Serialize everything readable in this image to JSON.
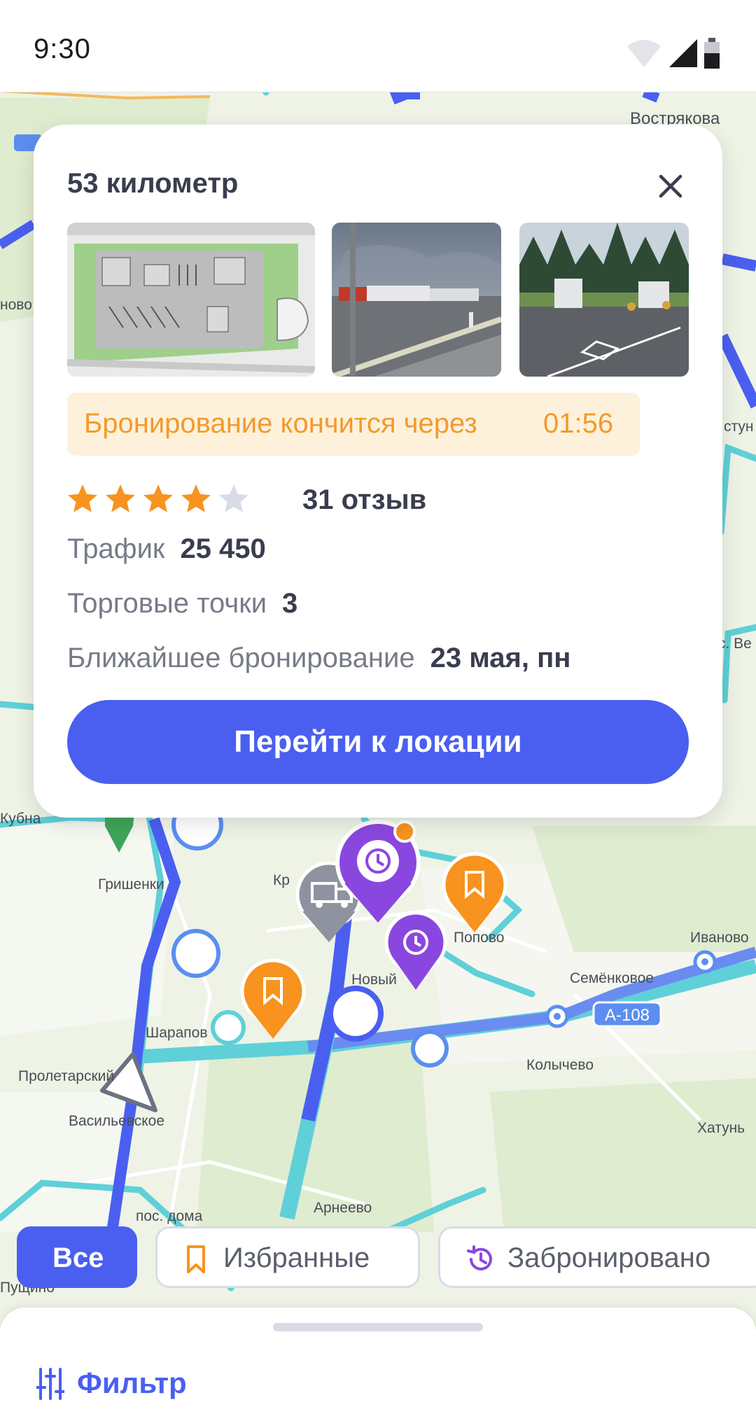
{
  "status_bar": {
    "time": "9:30",
    "icons": [
      "wifi-icon",
      "signal-icon",
      "battery-icon"
    ]
  },
  "map": {
    "places": [
      "Вострякова",
      "Кубна",
      "Гришенки",
      "Кр",
      "Попово",
      "Иваново",
      "Семёнковое",
      "Новый",
      "Шарапов",
      "Пролетарский",
      "Васильевское",
      "Колычево",
      "Хатунь",
      "пос. дома",
      "Арнеево",
      "Пущино",
      "ново",
      "с. Ве",
      "стун"
    ],
    "road_label": "А-108",
    "pin_icons": [
      "history-pin-icon",
      "bookmark-pin-icon",
      "truck-pin-icon",
      "location-pin-icon",
      "navigation-arrow-icon"
    ]
  },
  "card": {
    "title": "53 километр",
    "timer_label": "Бронирование кончится через",
    "timer_value": "01:56",
    "rating": 4,
    "rating_max": 5,
    "reviews": "31 отзыв",
    "traffic_label": "Трафик",
    "traffic_value": "25 450",
    "points_label": "Торговые точки",
    "points_value": "3",
    "booking_label": "Ближайшее бронирование",
    "booking_value": "23 мая, пн",
    "button_label": "Перейти к локации"
  },
  "chips": {
    "all": "Все",
    "favorites": "Избранные",
    "booked": "Забронировано"
  },
  "filter_label": "Фильтр",
  "colors": {
    "accent": "#4a5ff0",
    "timer_text": "#f39a2a",
    "timer_bg": "#fdf1dc",
    "star": "#f7931e",
    "purple_pin": "#8a47e0",
    "orange_pin": "#f7931e"
  }
}
